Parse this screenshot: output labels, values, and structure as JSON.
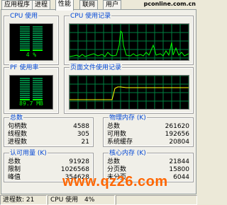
{
  "tabs": [
    {
      "label": "应用程序"
    },
    {
      "label": "进程"
    },
    {
      "label": "性能"
    },
    {
      "label": "联网"
    },
    {
      "label": "用户"
    }
  ],
  "watermark_top": "pconline.com.cn",
  "cpu_usage": {
    "title": "CPU 使用",
    "value": "4 %",
    "level": 0.04
  },
  "cpu_history": {
    "title": "CPU 使用记录"
  },
  "pf_usage": {
    "title": "PF 使用率",
    "value": "89.7 MB",
    "level": 0.09
  },
  "pf_history": {
    "title": "页面文件使用记录"
  },
  "totals": {
    "title": "总数",
    "rows": [
      {
        "k": "句柄数",
        "v": "4588"
      },
      {
        "k": "线程数",
        "v": "305"
      },
      {
        "k": "进程数",
        "v": "21"
      }
    ]
  },
  "physical": {
    "title": "物理内存 (K)",
    "rows": [
      {
        "k": "总数",
        "v": "261620"
      },
      {
        "k": "可用数",
        "v": "192656"
      },
      {
        "k": "系统缓存",
        "v": "20804"
      }
    ]
  },
  "commit": {
    "title": "认可用量 (K)",
    "rows": [
      {
        "k": "总数",
        "v": "91928"
      },
      {
        "k": "限制",
        "v": "1026568"
      },
      {
        "k": "峰值",
        "v": "354628"
      }
    ]
  },
  "kernel": {
    "title": "核心内存 (K)",
    "rows": [
      {
        "k": "总数",
        "v": "21844"
      },
      {
        "k": "分页数",
        "v": "15800"
      },
      {
        "k": "未分页",
        "v": "6044"
      }
    ]
  },
  "status": {
    "processes": "进程数: 21",
    "cpu": "CPU 使用",
    "cpu_value": "4%"
  },
  "watermark_url": "www.qz26.com",
  "colors": {
    "grid": "#008040",
    "line": "#00ff00",
    "pf_line": "#ffff00",
    "label": "#0046d5",
    "watermark": "#ff6600"
  }
}
